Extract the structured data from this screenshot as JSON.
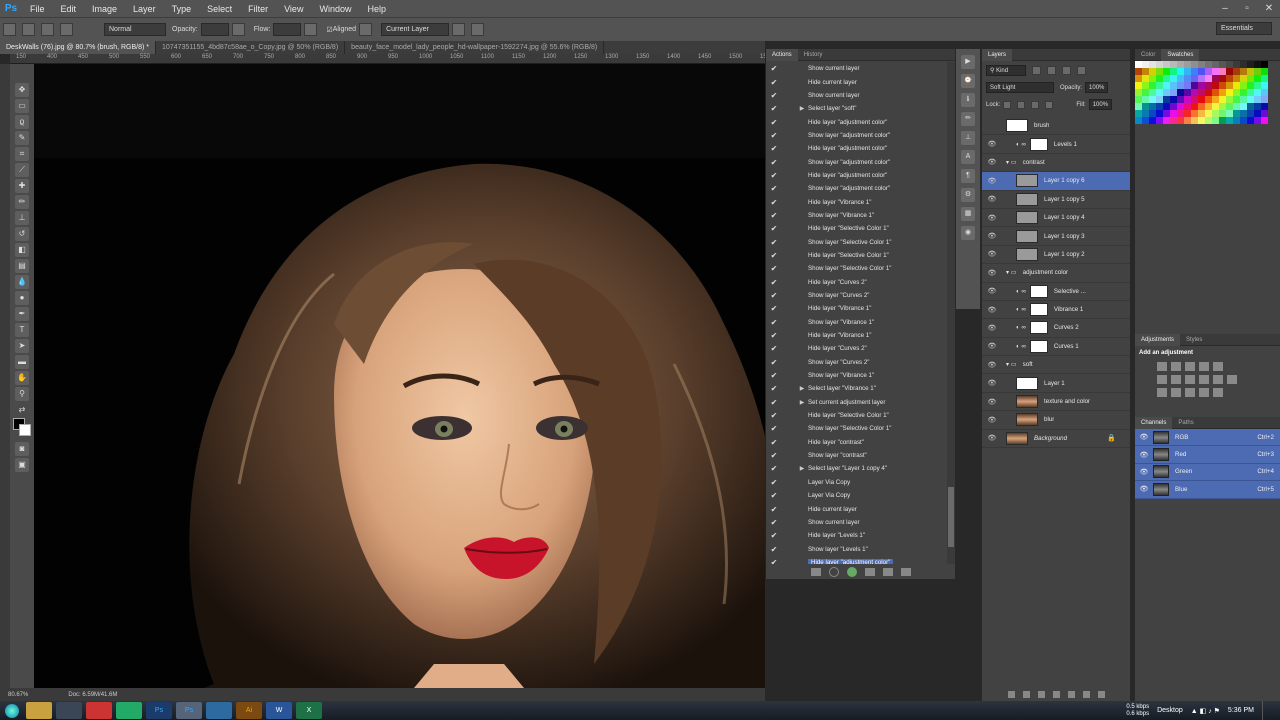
{
  "app": {
    "logo": "Ps",
    "workspace": "Essentials"
  },
  "menu": [
    "File",
    "Edit",
    "Image",
    "Layer",
    "Type",
    "Select",
    "Filter",
    "View",
    "Window",
    "Help"
  ],
  "options_bar": {
    "mode_label": "Normal",
    "opacity_label": "Opacity:",
    "flow_label": "Flow:",
    "aligned_label": "Aligned",
    "sample_value": "Current Layer"
  },
  "doc_tabs": [
    {
      "label": "DeskWalls (76).jpg @ 80.7% (brush, RGB/8) *",
      "active": true
    },
    {
      "label": "10747351155_4bd87c58ae_o_Copy.jpg @ 50% (RGB/8)",
      "active": false
    },
    {
      "label": "beauty_face_model_lady_people_hd-wallpaper-1592274.jpg @ 55.6% (RGB/8)",
      "active": false
    }
  ],
  "ruler_labels": [
    "150",
    "400",
    "450",
    "500",
    "550",
    "600",
    "650",
    "700",
    "750",
    "800",
    "850",
    "900",
    "950",
    "1000",
    "1050",
    "1100",
    "1150",
    "1200",
    "1250",
    "1300",
    "1350",
    "1400",
    "1450",
    "1500",
    "157"
  ],
  "status": {
    "zoom": "80.67%",
    "doc": "Doc: 6.59M/41.6M"
  },
  "actions_panel": {
    "tabs": [
      "Actions",
      "History"
    ],
    "items": [
      {
        "label": "Show current layer",
        "expandable": false,
        "selected": false
      },
      {
        "label": "Hide current layer",
        "expandable": false,
        "selected": false
      },
      {
        "label": "Show current layer",
        "expandable": false,
        "selected": false
      },
      {
        "label": "Select layer \"soft\"",
        "expandable": true,
        "selected": false
      },
      {
        "label": "Hide layer \"adjustment color\"",
        "expandable": false,
        "selected": false
      },
      {
        "label": "Show layer \"adjustment color\"",
        "expandable": false,
        "selected": false
      },
      {
        "label": "Hide layer \"adjustment color\"",
        "expandable": false,
        "selected": false
      },
      {
        "label": "Show layer \"adjustment color\"",
        "expandable": false,
        "selected": false
      },
      {
        "label": "Hide layer \"adjustment color\"",
        "expandable": false,
        "selected": false
      },
      {
        "label": "Show layer \"adjustment color\"",
        "expandable": false,
        "selected": false
      },
      {
        "label": "Hide layer \"Vibrance 1\"",
        "expandable": false,
        "selected": false
      },
      {
        "label": "Show layer \"Vibrance 1\"",
        "expandable": false,
        "selected": false
      },
      {
        "label": "Hide layer \"Selective Color 1\"",
        "expandable": false,
        "selected": false
      },
      {
        "label": "Show layer \"Selective Color 1\"",
        "expandable": false,
        "selected": false
      },
      {
        "label": "Hide layer \"Selective Color 1\"",
        "expandable": false,
        "selected": false
      },
      {
        "label": "Show layer \"Selective Color 1\"",
        "expandable": false,
        "selected": false
      },
      {
        "label": "Hide layer \"Curves 2\"",
        "expandable": false,
        "selected": false
      },
      {
        "label": "Show layer \"Curves 2\"",
        "expandable": false,
        "selected": false
      },
      {
        "label": "Hide layer \"Vibrance 1\"",
        "expandable": false,
        "selected": false
      },
      {
        "label": "Show layer \"Vibrance 1\"",
        "expandable": false,
        "selected": false
      },
      {
        "label": "Hide layer \"Vibrance 1\"",
        "expandable": false,
        "selected": false
      },
      {
        "label": "Hide layer \"Curves 2\"",
        "expandable": false,
        "selected": false
      },
      {
        "label": "Show layer \"Curves 2\"",
        "expandable": false,
        "selected": false
      },
      {
        "label": "Show layer \"Vibrance 1\"",
        "expandable": false,
        "selected": false
      },
      {
        "label": "Select layer \"Vibrance 1\"",
        "expandable": true,
        "selected": false
      },
      {
        "label": "Set current adjustment layer",
        "expandable": true,
        "selected": false
      },
      {
        "label": "Hide layer \"Selective Color 1\"",
        "expandable": false,
        "selected": false
      },
      {
        "label": "Show layer \"Selective Color 1\"",
        "expandable": false,
        "selected": false
      },
      {
        "label": "Hide layer \"contrast\"",
        "expandable": false,
        "selected": false
      },
      {
        "label": "Show layer \"contrast\"",
        "expandable": false,
        "selected": false
      },
      {
        "label": "Select layer \"Layer 1 copy 4\"",
        "expandable": true,
        "selected": false
      },
      {
        "label": "Layer Via Copy",
        "expandable": false,
        "selected": false
      },
      {
        "label": "Layer Via Copy",
        "expandable": false,
        "selected": false
      },
      {
        "label": "Hide current layer",
        "expandable": false,
        "selected": false
      },
      {
        "label": "Show current layer",
        "expandable": false,
        "selected": false
      },
      {
        "label": "Hide layer \"Levels 1\"",
        "expandable": false,
        "selected": false
      },
      {
        "label": "Show layer \"Levels 1\"",
        "expandable": false,
        "selected": false
      },
      {
        "label": "Hide layer \"adjustment color\"",
        "expandable": false,
        "selected": true
      }
    ]
  },
  "layers_panel": {
    "tab": "Layers",
    "kind_label": "Kind",
    "blend_mode": "Soft Light",
    "opacity_label": "Opacity:",
    "opacity_value": "100%",
    "lock_label": "Lock:",
    "fill_label": "Fill:",
    "fill_value": "100%",
    "layers": [
      {
        "name": "brush",
        "indent": 0,
        "type": "layer",
        "eye": false,
        "selected": false
      },
      {
        "name": "Levels 1",
        "indent": 1,
        "type": "adjustment",
        "eye": true,
        "selected": false
      },
      {
        "name": "contrast",
        "indent": 0,
        "type": "group",
        "eye": true,
        "selected": false
      },
      {
        "name": "Layer 1 copy 6",
        "indent": 1,
        "type": "layer",
        "eye": true,
        "selected": true
      },
      {
        "name": "Layer 1 copy 5",
        "indent": 1,
        "type": "layer",
        "eye": true,
        "selected": false
      },
      {
        "name": "Layer 1 copy 4",
        "indent": 1,
        "type": "layer",
        "eye": true,
        "selected": false
      },
      {
        "name": "Layer 1 copy 3",
        "indent": 1,
        "type": "layer",
        "eye": true,
        "selected": false
      },
      {
        "name": "Layer 1 copy 2",
        "indent": 1,
        "type": "layer",
        "eye": true,
        "selected": false
      },
      {
        "name": "adjustment color",
        "indent": 0,
        "type": "group",
        "eye": true,
        "selected": false
      },
      {
        "name": "Selective ...",
        "indent": 1,
        "type": "adjustment",
        "eye": true,
        "selected": false
      },
      {
        "name": "Vibrance 1",
        "indent": 1,
        "type": "adjustment",
        "eye": true,
        "selected": false
      },
      {
        "name": "Curves 2",
        "indent": 1,
        "type": "adjustment",
        "eye": true,
        "selected": false
      },
      {
        "name": "Curves 1",
        "indent": 1,
        "type": "adjustment",
        "eye": true,
        "selected": false
      },
      {
        "name": "soft",
        "indent": 0,
        "type": "group",
        "eye": true,
        "selected": false
      },
      {
        "name": "Layer 1",
        "indent": 1,
        "type": "layer",
        "eye": true,
        "selected": false
      },
      {
        "name": "texture and color",
        "indent": 1,
        "type": "photo",
        "eye": true,
        "selected": false
      },
      {
        "name": "blur",
        "indent": 1,
        "type": "photo",
        "eye": true,
        "selected": false
      },
      {
        "name": "Background",
        "indent": 0,
        "type": "background",
        "eye": true,
        "selected": false
      }
    ]
  },
  "right_panel": {
    "swatch_tabs": [
      "Color",
      "Swatches"
    ],
    "adj_tabs": [
      "Adjustments",
      "Styles"
    ],
    "adj_title": "Add an adjustment",
    "channel_tabs": [
      "Channels",
      "Paths"
    ],
    "channels": [
      {
        "name": "RGB",
        "shortcut": "Ctrl+2"
      },
      {
        "name": "Red",
        "shortcut": "Ctrl+3"
      },
      {
        "name": "Green",
        "shortcut": "Ctrl+4"
      },
      {
        "name": "Blue",
        "shortcut": "Ctrl+5"
      }
    ]
  },
  "taskbar": {
    "apps": [
      "folder",
      "media",
      "chrome",
      "chrome2",
      "ps",
      "ps2",
      "explorer",
      "ai",
      "word",
      "excel"
    ],
    "net": "0.5 kbps\n0.6 kbps",
    "desktop_label": "Desktop",
    "time": "5:36 PM"
  },
  "colors": {
    "selection": "#4d6bb3",
    "panel": "#424242",
    "accent": "#31a8ff"
  }
}
